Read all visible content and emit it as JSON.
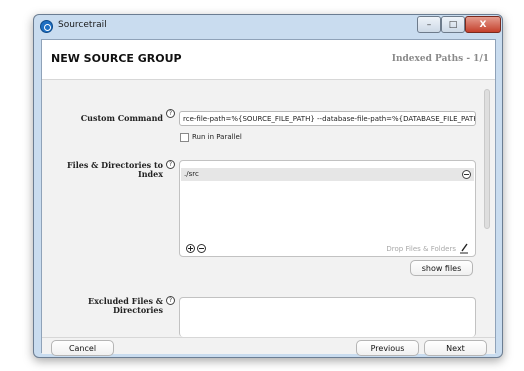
{
  "window": {
    "title": "Sourcetrail",
    "controls": {
      "minimize": "–",
      "maximize": "□",
      "close": "X"
    }
  },
  "header": {
    "title": "NEW SOURCE GROUP",
    "counter": "Indexed Paths - 1/1"
  },
  "form": {
    "custom_command": {
      "label": "Custom Command",
      "value": "rce-file-path=%{SOURCE_FILE_PATH} --database-file-path=%{DATABASE_FILE_PATH}"
    },
    "run_in_parallel": {
      "label": "Run in Parallel",
      "checked": false
    },
    "files_directories": {
      "label_line1": "Files & Directories to",
      "label_line2": "Index",
      "items": [
        "./src"
      ],
      "drop_hint": "Drop Files & Folders",
      "show_files_label": "show files"
    },
    "excluded": {
      "label_line1": "Excluded Files &",
      "label_line2": "Directories"
    }
  },
  "footer": {
    "cancel_label": "Cancel",
    "previous_label": "Previous",
    "next_label": "Next"
  },
  "icons": {
    "app": "sourcetrail-icon",
    "help": "help-icon",
    "add": "add-icon",
    "remove": "remove-icon",
    "edit": "edit-icon"
  },
  "help_glyph": "?"
}
